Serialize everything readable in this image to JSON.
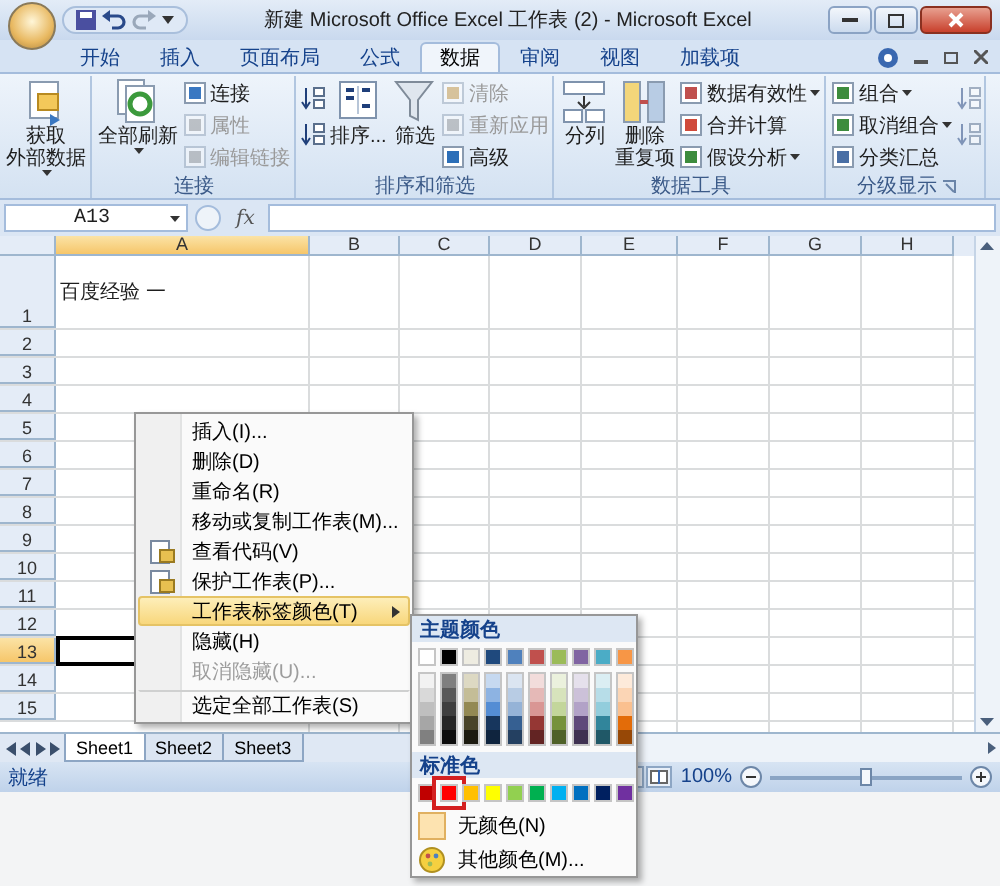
{
  "window": {
    "title": "新建 Microsoft Office Excel 工作表 (2) - Microsoft Excel"
  },
  "ribbon_tabs": [
    {
      "label": "开始",
      "selected": false
    },
    {
      "label": "插入",
      "selected": false
    },
    {
      "label": "页面布局",
      "selected": false
    },
    {
      "label": "公式",
      "selected": false
    },
    {
      "label": "数据",
      "selected": true
    },
    {
      "label": "审阅",
      "selected": false
    },
    {
      "label": "视图",
      "selected": false
    },
    {
      "label": "加载项",
      "selected": false
    }
  ],
  "ribbon_groups": [
    {
      "launcher": false,
      "columns": [
        [
          {
            "kind": "large",
            "label_lines": [
              "获取",
              "外部数据"
            ],
            "dropdown": true,
            "disabled": false
          }
        ]
      ]
    },
    {
      "label": "连接",
      "launcher": false,
      "columns": [
        [
          {
            "kind": "large",
            "label_lines": [
              "全部刷新"
            ],
            "dropdown": true,
            "disabled": false
          }
        ],
        [
          {
            "kind": "small",
            "label": "连接",
            "dropdown": false,
            "disabled": false
          },
          {
            "kind": "small",
            "label": "属性",
            "dropdown": false,
            "disabled": true
          },
          {
            "kind": "small",
            "label": "编辑链接",
            "dropdown": false,
            "disabled": true
          }
        ]
      ]
    },
    {
      "label": "排序和筛选",
      "launcher": false,
      "columns": [
        [
          {
            "kind": "icon",
            "disabled": false
          },
          {
            "kind": "icon",
            "disabled": false
          }
        ],
        [
          {
            "kind": "large",
            "label_lines": [
              "排序..."
            ],
            "dropdown": false,
            "disabled": false
          }
        ],
        [
          {
            "kind": "large",
            "label_lines": [
              "筛选"
            ],
            "dropdown": false,
            "disabled": false
          }
        ],
        [
          {
            "kind": "small",
            "label": "清除",
            "dropdown": false,
            "disabled": true
          },
          {
            "kind": "small",
            "label": "重新应用",
            "dropdown": false,
            "disabled": true
          },
          {
            "kind": "small",
            "label": "高级",
            "dropdown": false,
            "disabled": false
          }
        ]
      ]
    },
    {
      "label": "数据工具",
      "launcher": false,
      "columns": [
        [
          {
            "kind": "large",
            "label_lines": [
              "分列"
            ],
            "dropdown": false,
            "disabled": false
          }
        ],
        [
          {
            "kind": "large",
            "label_lines": [
              "删除",
              "重复项"
            ],
            "dropdown": false,
            "disabled": false
          }
        ],
        [
          {
            "kind": "small",
            "label": "数据有效性",
            "dropdown": true,
            "disabled": false
          },
          {
            "kind": "small",
            "label": "合并计算",
            "dropdown": false,
            "disabled": false
          },
          {
            "kind": "small",
            "label": "假设分析",
            "dropdown": true,
            "disabled": false
          }
        ]
      ]
    },
    {
      "label": "分级显示",
      "launcher": true,
      "columns": [
        [
          {
            "kind": "small",
            "label": "组合",
            "dropdown": true,
            "disabled": false
          },
          {
            "kind": "small",
            "label": "取消组合",
            "dropdown": true,
            "disabled": false
          },
          {
            "kind": "small",
            "label": "分类汇总",
            "dropdown": false,
            "disabled": false
          }
        ],
        [
          {
            "kind": "icon",
            "disabled": true
          },
          {
            "kind": "icon",
            "disabled": true
          }
        ]
      ]
    }
  ],
  "name_box": "A13",
  "function_label": "fx",
  "grid": {
    "columns": [
      {
        "label": "A",
        "selected": true
      },
      {
        "label": "B",
        "selected": false
      },
      {
        "label": "C",
        "selected": false
      },
      {
        "label": "D",
        "selected": false
      },
      {
        "label": "E",
        "selected": false
      },
      {
        "label": "F",
        "selected": false
      },
      {
        "label": "G",
        "selected": false
      },
      {
        "label": "H",
        "selected": false
      }
    ],
    "rows": [
      {
        "label": "1",
        "selected": false,
        "cells": [
          "百度经验 一"
        ]
      },
      {
        "label": "2",
        "selected": false
      },
      {
        "label": "3",
        "selected": false
      },
      {
        "label": "4",
        "selected": false
      },
      {
        "label": "5",
        "selected": false
      },
      {
        "label": "6",
        "selected": false
      },
      {
        "label": "7",
        "selected": false
      },
      {
        "label": "8",
        "selected": false
      },
      {
        "label": "9",
        "selected": false
      },
      {
        "label": "10",
        "selected": false
      },
      {
        "label": "11",
        "selected": false
      },
      {
        "label": "12",
        "selected": false
      },
      {
        "label": "13",
        "selected": true
      },
      {
        "label": "14",
        "selected": false
      },
      {
        "label": "15",
        "selected": false
      }
    ]
  },
  "sheet_tabs": [
    {
      "label": "Sheet1",
      "selected": true
    },
    {
      "label": "Sheet2",
      "selected": false
    },
    {
      "label": "Sheet3",
      "selected": false
    }
  ],
  "status_bar": {
    "status": "就绪",
    "zoom": "100%",
    "level": 0.5
  },
  "context_menu": [
    {
      "label": "插入(I)...",
      "disabled": false,
      "selected": false,
      "submenu": false,
      "icon": false,
      "separator_before": false
    },
    {
      "label": "删除(D)",
      "disabled": false,
      "selected": false,
      "submenu": false,
      "icon": false,
      "separator_before": false
    },
    {
      "label": "重命名(R)",
      "disabled": false,
      "selected": false,
      "submenu": false,
      "icon": false,
      "separator_before": false
    },
    {
      "label": "移动或复制工作表(M)...",
      "disabled": false,
      "selected": false,
      "submenu": false,
      "icon": false,
      "separator_before": false
    },
    {
      "label": "查看代码(V)",
      "disabled": false,
      "selected": false,
      "submenu": false,
      "icon": true,
      "separator_before": false
    },
    {
      "label": "保护工作表(P)...",
      "disabled": false,
      "selected": false,
      "submenu": false,
      "icon": true,
      "separator_before": false
    },
    {
      "label": "工作表标签颜色(T)",
      "disabled": false,
      "selected": true,
      "submenu": true,
      "icon": false,
      "separator_before": false
    },
    {
      "label": "隐藏(H)",
      "disabled": false,
      "selected": false,
      "submenu": false,
      "icon": false,
      "separator_before": false
    },
    {
      "label": "取消隐藏(U)...",
      "disabled": true,
      "selected": false,
      "submenu": false,
      "icon": false,
      "separator_before": false
    },
    {
      "label": "选定全部工作表(S)",
      "disabled": false,
      "selected": false,
      "submenu": false,
      "icon": false,
      "separator_before": true
    }
  ],
  "color_menu": {
    "theme_title": "主题颜色",
    "theme_colors": [
      {
        "color": "#ffffff",
        "shades": [
          {
            "color": "#f2f2f2"
          },
          {
            "color": "#d9d9d9"
          },
          {
            "color": "#bfbfbf"
          },
          {
            "color": "#a6a6a6"
          },
          {
            "color": "#808080"
          }
        ]
      },
      {
        "color": "#000000",
        "shades": [
          {
            "color": "#7f7f7f"
          },
          {
            "color": "#595959"
          },
          {
            "color": "#3f3f3f"
          },
          {
            "color": "#262626"
          },
          {
            "color": "#0d0d0d"
          }
        ]
      },
      {
        "color": "#eeece1",
        "shades": [
          {
            "color": "#ddd9c3"
          },
          {
            "color": "#c4bd97"
          },
          {
            "color": "#938953"
          },
          {
            "color": "#494429"
          },
          {
            "color": "#1d1b10"
          }
        ]
      },
      {
        "color": "#1f497d",
        "shades": [
          {
            "color": "#c6d9f0"
          },
          {
            "color": "#8db3e2"
          },
          {
            "color": "#548dd4"
          },
          {
            "color": "#17365d"
          },
          {
            "color": "#0f243e"
          }
        ]
      },
      {
        "color": "#4f81bd",
        "shades": [
          {
            "color": "#dbe5f1"
          },
          {
            "color": "#b8cce4"
          },
          {
            "color": "#95b3d7"
          },
          {
            "color": "#366092"
          },
          {
            "color": "#244061"
          }
        ]
      },
      {
        "color": "#c0504d",
        "shades": [
          {
            "color": "#f2dcdb"
          },
          {
            "color": "#e5b9b7"
          },
          {
            "color": "#d99694"
          },
          {
            "color": "#953734"
          },
          {
            "color": "#632423"
          }
        ]
      },
      {
        "color": "#9bbb59",
        "shades": [
          {
            "color": "#ebf1dd"
          },
          {
            "color": "#d7e3bc"
          },
          {
            "color": "#c3d69b"
          },
          {
            "color": "#76923c"
          },
          {
            "color": "#4f6128"
          }
        ]
      },
      {
        "color": "#8064a2",
        "shades": [
          {
            "color": "#e5e0ec"
          },
          {
            "color": "#ccc1d9"
          },
          {
            "color": "#b2a2c7"
          },
          {
            "color": "#5f497a"
          },
          {
            "color": "#3f3151"
          }
        ]
      },
      {
        "color": "#4bacc6",
        "shades": [
          {
            "color": "#dbeef3"
          },
          {
            "color": "#b7dde8"
          },
          {
            "color": "#92cddc"
          },
          {
            "color": "#31859b"
          },
          {
            "color": "#205867"
          }
        ]
      },
      {
        "color": "#f79646",
        "shades": [
          {
            "color": "#fdeada"
          },
          {
            "color": "#fbd5b5"
          },
          {
            "color": "#fac08f"
          },
          {
            "color": "#e36c09"
          },
          {
            "color": "#974806"
          }
        ]
      }
    ],
    "standard_title": "标准色",
    "standard_colors": [
      {
        "color": "#c00000",
        "selected": false
      },
      {
        "color": "#ff0000",
        "selected": true
      },
      {
        "color": "#ffc000",
        "selected": false
      },
      {
        "color": "#ffff00",
        "selected": false
      },
      {
        "color": "#92d050",
        "selected": false
      },
      {
        "color": "#00b050",
        "selected": false
      },
      {
        "color": "#00b0f0",
        "selected": false
      },
      {
        "color": "#0070c0",
        "selected": false
      },
      {
        "color": "#002060",
        "selected": false
      },
      {
        "color": "#7030a0",
        "selected": false
      }
    ],
    "no_color": "无颜色(N)",
    "more_colors": "其他颜色(M)..."
  }
}
